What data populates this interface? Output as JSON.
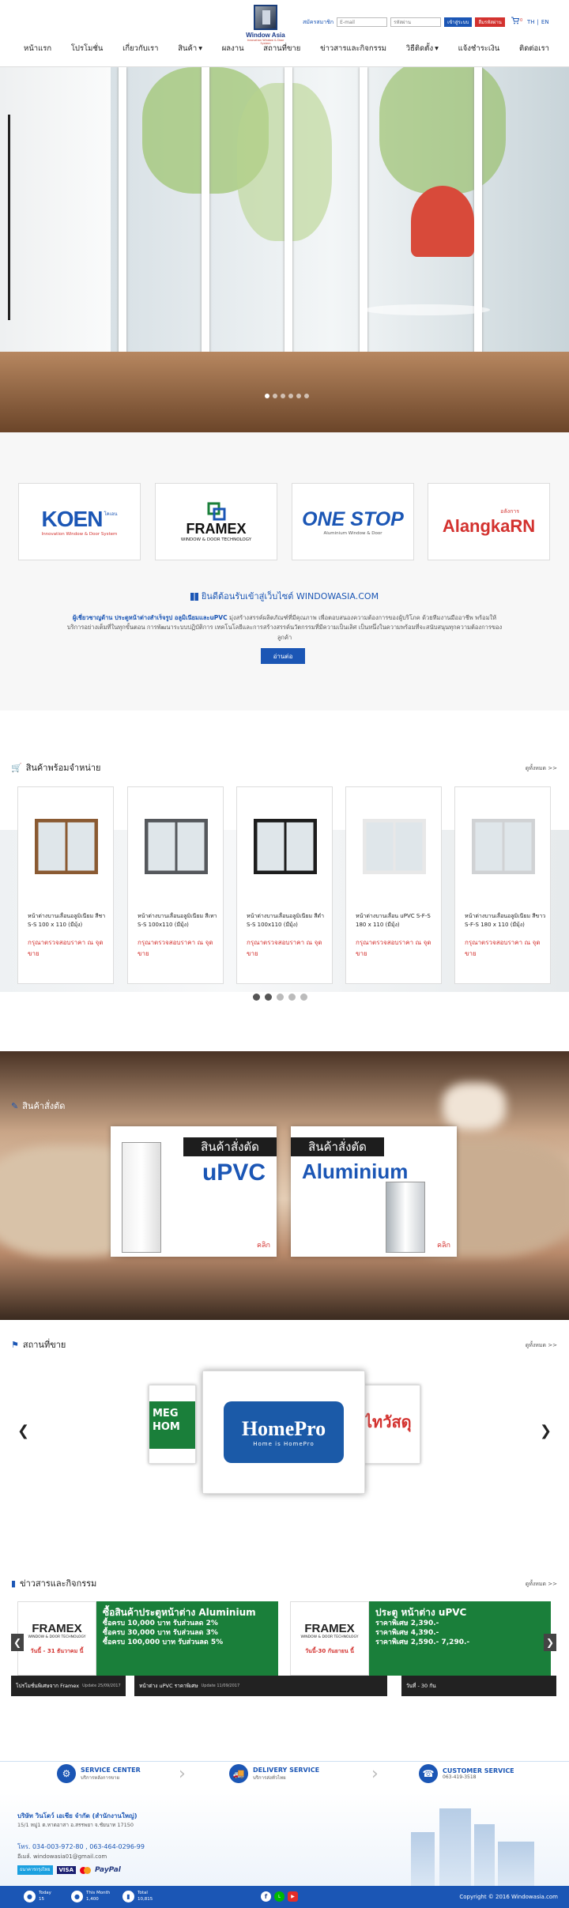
{
  "header": {
    "logo_name": "Window Asia",
    "logo_tagline": "Innovation Window & Door System",
    "signup_label": "สมัครสมาชิก",
    "email_placeholder": "E-mail",
    "password_placeholder": "รหัสผ่าน",
    "login_label": "เข้าสู่ระบบ",
    "register_label": "ลืมรหัสผ่าน",
    "cart_count": "0",
    "lang_th": "TH",
    "lang_sep": "|",
    "lang_en": "EN"
  },
  "nav": [
    {
      "label": "หน้าแรก",
      "dropdown": false
    },
    {
      "label": "โปรโมชั่น",
      "dropdown": false
    },
    {
      "label": "เกี่ยวกับเรา",
      "dropdown": false
    },
    {
      "label": "สินค้า",
      "dropdown": true
    },
    {
      "label": "ผลงาน",
      "dropdown": false
    },
    {
      "label": "สถานที่ขาย",
      "dropdown": false
    },
    {
      "label": "ข่าวสารและกิจกรรม",
      "dropdown": false
    },
    {
      "label": "วิธีติดตั้ง",
      "dropdown": true
    },
    {
      "label": "แจ้งชำระเงิน",
      "dropdown": false
    },
    {
      "label": "ติดต่อเรา",
      "dropdown": false
    }
  ],
  "brands": [
    {
      "name": "KOEN",
      "sub": "Innovation Window & Door System",
      "thai": "โคเอน"
    },
    {
      "name": "FRAMEX",
      "sub": "WINDOW & DOOR TECHNOLOGY"
    },
    {
      "name": "ONE STOP",
      "sub": "Aluminium Window & Door"
    },
    {
      "name": "AlangkaRN",
      "thai": "อลังการ"
    }
  ],
  "welcome": {
    "title": "ยินดีต้อนรับเข้าสู่เว็บไซต์ WINDOWASIA.COM",
    "intro_bold": "ผู้เชี่ยวชาญด้าน ประตูหน้าต่างสำเร็จรูป อลูมิเนียมและuPVC",
    "intro_rest": "มุ่งสร้างสรรค์ผลิตภัณฑ์ที่มีคุณภาพ เพื่อตอบสนองความต้องการของผู้บริโภค ด้วยทีมงานมืออาชีพ พร้อมให้บริการอย่างเต็มที่ในทุกขั้นตอน การพัฒนาระบบปฏิบัติการ เทคโนโลยีและการสร้างสรรค์นวัตกรรมที่มีความเป็นเลิศ เป็นหนึ่งในความพร้อมที่จะสนับสนุนทุกความต้องการของลูกค้า",
    "read_more": "อ่านต่อ"
  },
  "products": {
    "title": "สินค้าพร้อมจำหน่าย",
    "see_more": "ดูทั้งหมด >>",
    "items": [
      {
        "name": "หน้าต่างบานเลื่อนอลูมิเนียม สีชา S-S 100 x 110 (มีมุ้ง)",
        "price": "กรุณาตรวจสอบราคา ณ จุดขาย",
        "frame": "#8a5a32"
      },
      {
        "name": "หน้าต่างบานเลื่อนอลูมิเนียม สีเทา S-S 100x110 (มีมุ้ง)",
        "price": "กรุณาตรวจสอบราคา ณ จุดขาย",
        "frame": "#55585c"
      },
      {
        "name": "หน้าต่างบานเลื่อนอลูมิเนียม สีดำ S-S 100x110 (มีมุ้ง)",
        "price": "กรุณาตรวจสอบราคา ณ จุดขาย",
        "frame": "#1d1d1d"
      },
      {
        "name": "หน้าต่างบานเลื่อน uPVC S-F-S 180 x 110 (มีมุ้ง)",
        "price": "กรุณาตรวจสอบราคา ณ จุดขาย",
        "frame": "#e8e8e8"
      },
      {
        "name": "หน้าต่างบานเลื่อนอลูมิเนียม สีขาว S-F-S 180 x 110 (มีมุ้ง)",
        "price": "กรุณาตรวจสอบราคา ณ จุดขาย",
        "frame": "#d0d2d4"
      }
    ]
  },
  "custom": {
    "title": "สินค้าสั่งตัด",
    "cards": [
      {
        "tag": "สินค้าสั่งตัด",
        "material": "uPVC",
        "click": "คลิก"
      },
      {
        "tag": "สินค้าสั่งตัด",
        "material": "Aluminium",
        "click": "คลิก"
      }
    ]
  },
  "stores": {
    "title": "สถานที่ขาย",
    "see_more": "ดูทั้งหมด >>",
    "center_name": "HomePro",
    "center_tagline": "Home is HomePro",
    "left_partial": "MEG HOM",
    "right_partial": "ไทวัสดุ"
  },
  "news": {
    "title": "ข่าวสารและกิจกรรม",
    "see_more": "ดูทั้งหมด >>",
    "items": [
      {
        "brand": "FRAMEX",
        "brand_sub": "WINDOW & DOOR TECHNOLOGY",
        "headline": "ซื้อสินค้าประตูหน้าต่าง Aluminium",
        "lines": [
          "ซื้อครบ 10,000 บาท รับส่วนลด 2%",
          "ซื้อครบ 30,000 บาท รับส่วนลด 3%",
          "ซื้อครบ 100,000 บาท รับส่วนลด 5%"
        ],
        "date": "วันนี้ - 31 ธันวาคม นี้",
        "caption": "โปรโมชั่นพิเศษจาก Framex",
        "update": "Update 25/09/2017"
      },
      {
        "brand": "FRAMEX",
        "brand_sub": "WINDOW & DOOR TECHNOLOGY",
        "headline": "ประตู หน้าต่าง uPVC",
        "lines": [
          "ราคาพิเศษ 2,390.-",
          "ราคาพิเศษ 4,390.-",
          "ราคาพิเศษ 2,590.-  7,290.-"
        ],
        "date": "วันนี้-30 กันยายน นี้",
        "caption": "หน้าต่าง uPVC ราคาพิเศษ",
        "update": "Update 11/09/2017"
      }
    ],
    "strip_extra": "วันที่ - 30 กัน"
  },
  "services": [
    {
      "title": "SERVICE CENTER",
      "sub": "บริการหลังการขาย"
    },
    {
      "title": "DELIVERY SERVICE",
      "sub": "บริการส่งทั่วไทย"
    },
    {
      "title": "CUSTOMER SERVICE",
      "sub": "063-419-3518"
    }
  ],
  "footer": {
    "company": "บริษัท วินโดว์ เอเชีย จำกัด (สำนักงานใหญ่)",
    "address": "15/1 หมู่1 ต.หาดอาสา อ.สรรพยา จ.ชัยนาท 17150",
    "tel": "โทร. 034-003-972-80 , 063-464-0296-99",
    "email": "อีเมล์. windowasia01@gmail.com",
    "payments": [
      "ธนาคารกรุงไทย",
      "VISA",
      "MasterCard",
      "PayPal"
    ]
  },
  "bottom": {
    "stats": [
      {
        "label": "Today",
        "value": "15"
      },
      {
        "label": "This Month",
        "value": "1,400"
      },
      {
        "label": "Total",
        "value": "10,815"
      }
    ],
    "copyright": "Copyright © 2016 Windowasia.com"
  },
  "colors": {
    "primary": "#1b56b5",
    "accent_red": "#d3322f",
    "news_green": "#1a7f3a"
  }
}
